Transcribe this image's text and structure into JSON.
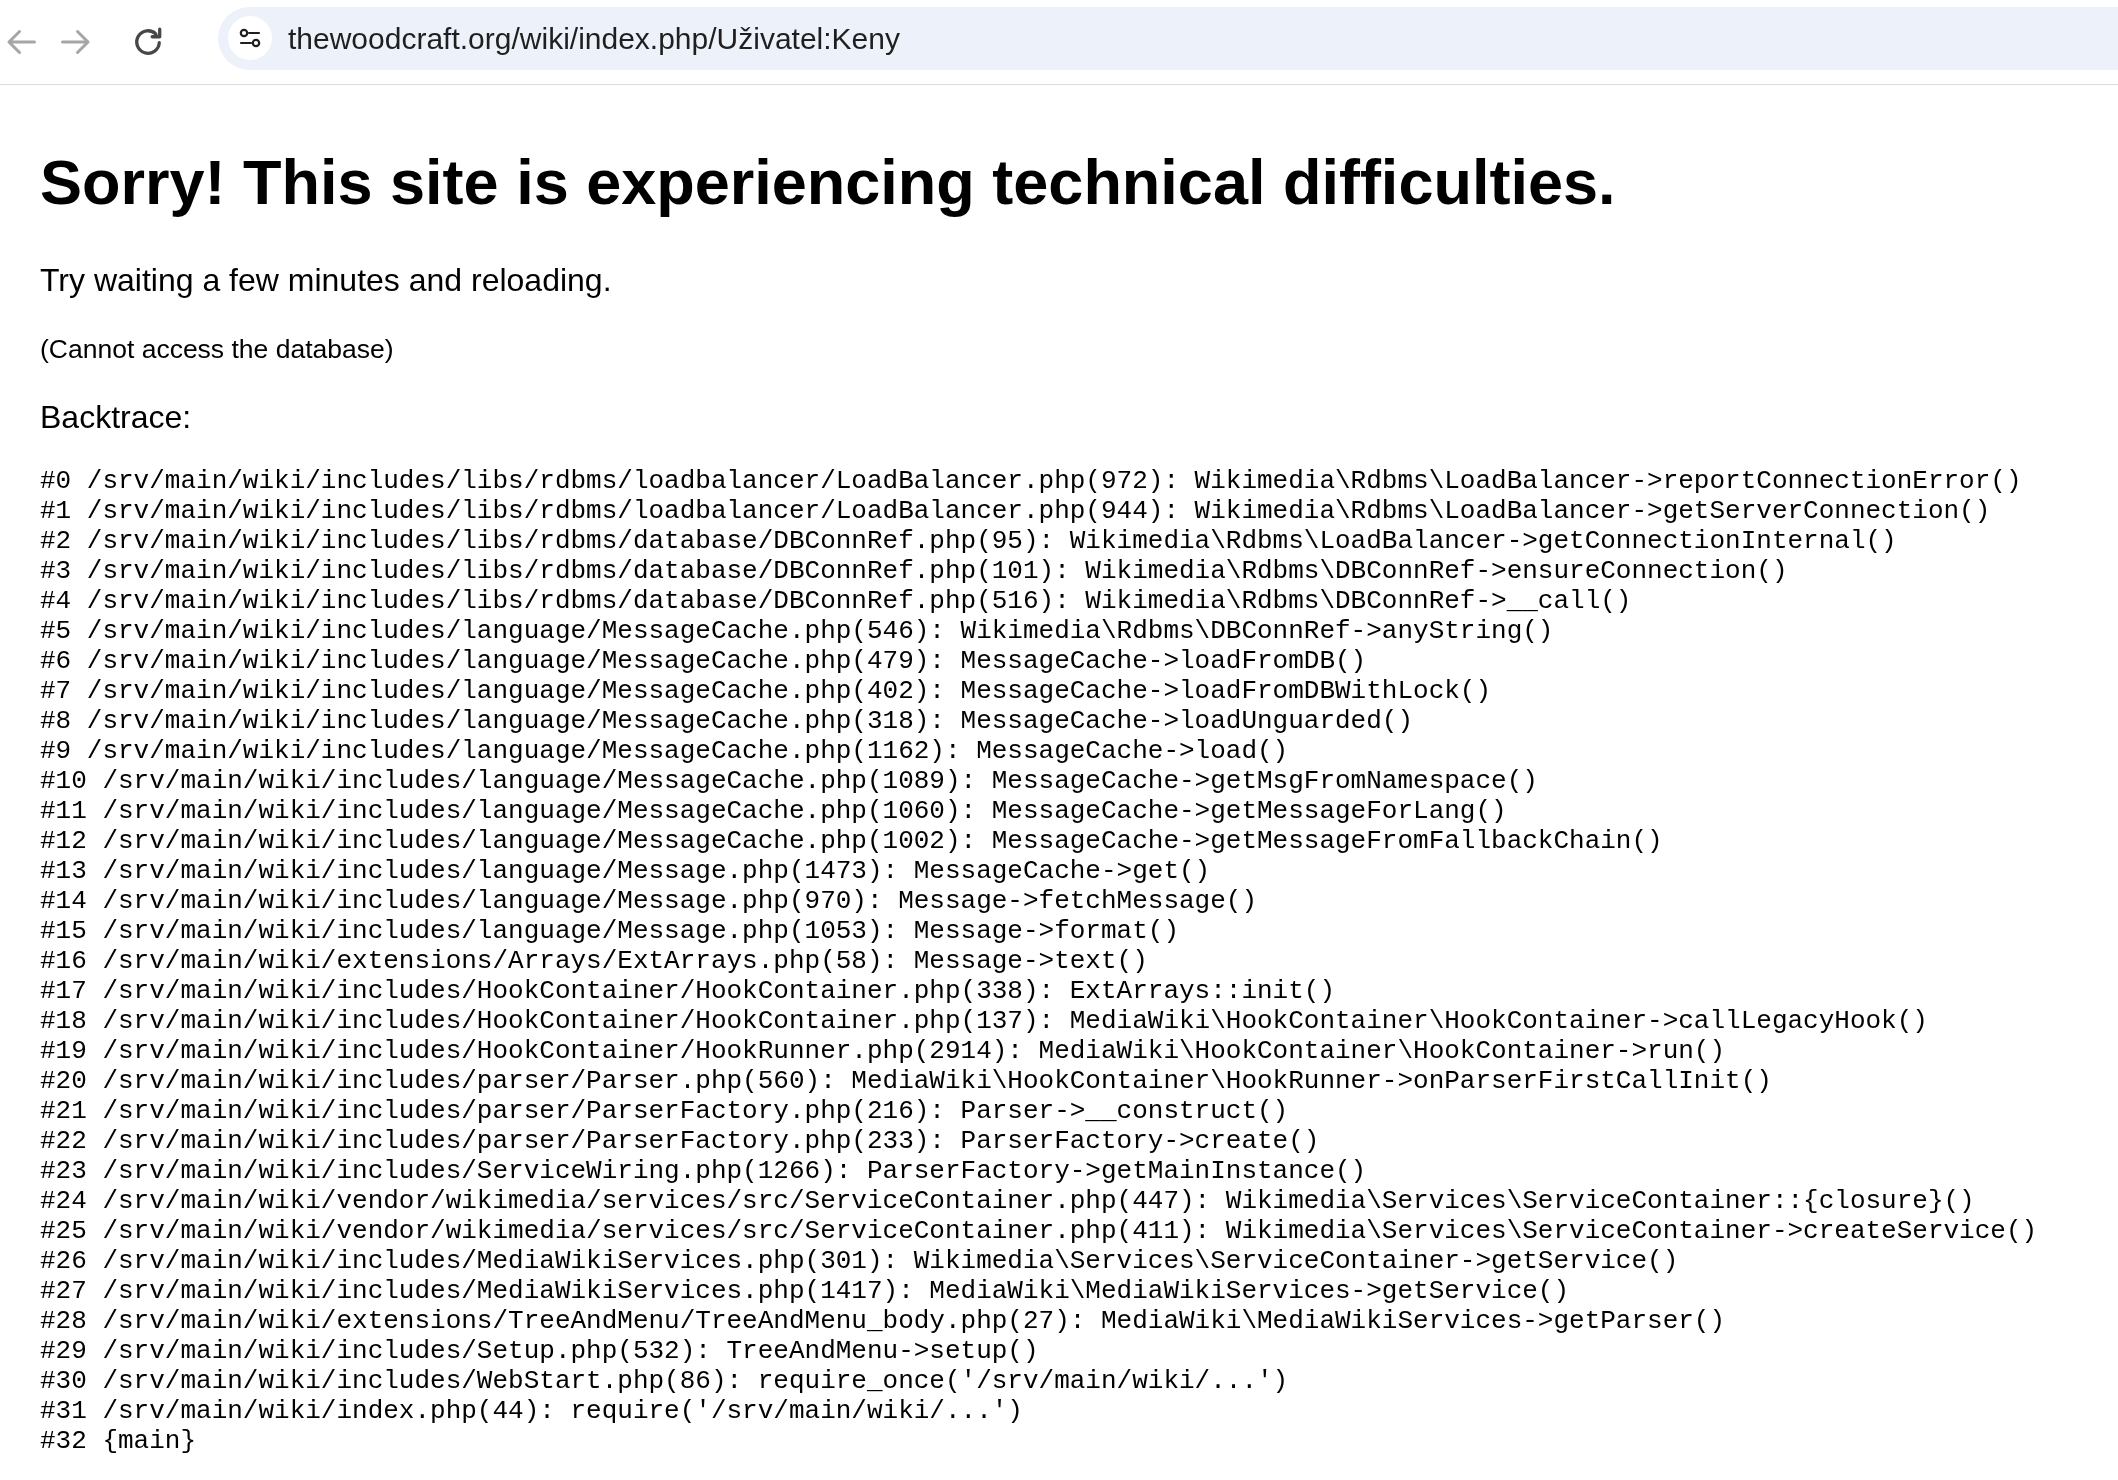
{
  "browser": {
    "nav_buttons": [
      {
        "kind": "back",
        "disabled": true
      },
      {
        "kind": "forward",
        "disabled": true
      },
      {
        "kind": "reload",
        "disabled": false
      }
    ],
    "url": "thewoodcraft.org/wiki/index.php/Uživatel:Keny"
  },
  "page": {
    "title": "Sorry! This site is experiencing technical difficulties.",
    "message": "Try waiting a few minutes and reloading.",
    "error_detail": "(Cannot access the database)",
    "backtrace_label": "Backtrace:",
    "backtrace": [
      "#0 /srv/main/wiki/includes/libs/rdbms/loadbalancer/LoadBalancer.php(972): Wikimedia\\Rdbms\\LoadBalancer->reportConnectionError()",
      "#1 /srv/main/wiki/includes/libs/rdbms/loadbalancer/LoadBalancer.php(944): Wikimedia\\Rdbms\\LoadBalancer->getServerConnection()",
      "#2 /srv/main/wiki/includes/libs/rdbms/database/DBConnRef.php(95): Wikimedia\\Rdbms\\LoadBalancer->getConnectionInternal()",
      "#3 /srv/main/wiki/includes/libs/rdbms/database/DBConnRef.php(101): Wikimedia\\Rdbms\\DBConnRef->ensureConnection()",
      "#4 /srv/main/wiki/includes/libs/rdbms/database/DBConnRef.php(516): Wikimedia\\Rdbms\\DBConnRef->__call()",
      "#5 /srv/main/wiki/includes/language/MessageCache.php(546): Wikimedia\\Rdbms\\DBConnRef->anyString()",
      "#6 /srv/main/wiki/includes/language/MessageCache.php(479): MessageCache->loadFromDB()",
      "#7 /srv/main/wiki/includes/language/MessageCache.php(402): MessageCache->loadFromDBWithLock()",
      "#8 /srv/main/wiki/includes/language/MessageCache.php(318): MessageCache->loadUnguarded()",
      "#9 /srv/main/wiki/includes/language/MessageCache.php(1162): MessageCache->load()",
      "#10 /srv/main/wiki/includes/language/MessageCache.php(1089): MessageCache->getMsgFromNamespace()",
      "#11 /srv/main/wiki/includes/language/MessageCache.php(1060): MessageCache->getMessageForLang()",
      "#12 /srv/main/wiki/includes/language/MessageCache.php(1002): MessageCache->getMessageFromFallbackChain()",
      "#13 /srv/main/wiki/includes/language/Message.php(1473): MessageCache->get()",
      "#14 /srv/main/wiki/includes/language/Message.php(970): Message->fetchMessage()",
      "#15 /srv/main/wiki/includes/language/Message.php(1053): Message->format()",
      "#16 /srv/main/wiki/extensions/Arrays/ExtArrays.php(58): Message->text()",
      "#17 /srv/main/wiki/includes/HookContainer/HookContainer.php(338): ExtArrays::init()",
      "#18 /srv/main/wiki/includes/HookContainer/HookContainer.php(137): MediaWiki\\HookContainer\\HookContainer->callLegacyHook()",
      "#19 /srv/main/wiki/includes/HookContainer/HookRunner.php(2914): MediaWiki\\HookContainer\\HookContainer->run()",
      "#20 /srv/main/wiki/includes/parser/Parser.php(560): MediaWiki\\HookContainer\\HookRunner->onParserFirstCallInit()",
      "#21 /srv/main/wiki/includes/parser/ParserFactory.php(216): Parser->__construct()",
      "#22 /srv/main/wiki/includes/parser/ParserFactory.php(233): ParserFactory->create()",
      "#23 /srv/main/wiki/includes/ServiceWiring.php(1266): ParserFactory->getMainInstance()",
      "#24 /srv/main/wiki/vendor/wikimedia/services/src/ServiceContainer.php(447): Wikimedia\\Services\\ServiceContainer::{closure}()",
      "#25 /srv/main/wiki/vendor/wikimedia/services/src/ServiceContainer.php(411): Wikimedia\\Services\\ServiceContainer->createService()",
      "#26 /srv/main/wiki/includes/MediaWikiServices.php(301): Wikimedia\\Services\\ServiceContainer->getService()",
      "#27 /srv/main/wiki/includes/MediaWikiServices.php(1417): MediaWiki\\MediaWikiServices->getService()",
      "#28 /srv/main/wiki/extensions/TreeAndMenu/TreeAndMenu_body.php(27): MediaWiki\\MediaWikiServices->getParser()",
      "#29 /srv/main/wiki/includes/Setup.php(532): TreeAndMenu->setup()",
      "#30 /srv/main/wiki/includes/WebStart.php(86): require_once('/srv/main/wiki/...')",
      "#31 /srv/main/wiki/index.php(44): require('/srv/main/wiki/...')",
      "#32 {main}"
    ]
  }
}
